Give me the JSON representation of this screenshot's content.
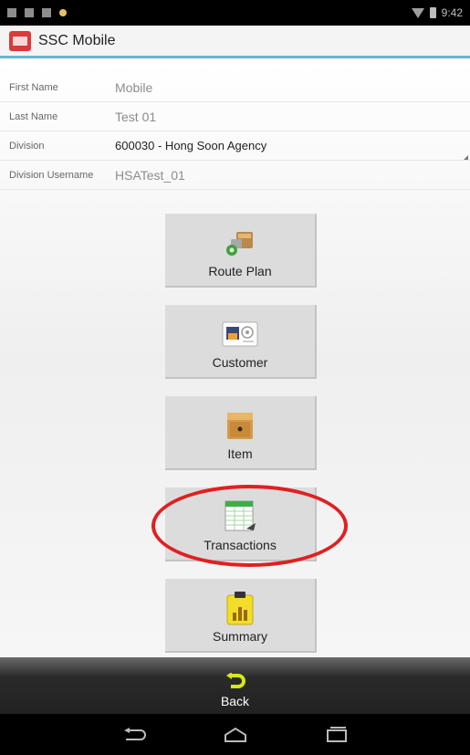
{
  "status_bar": {
    "time": "9:42"
  },
  "app": {
    "title": "SSC Mobile"
  },
  "profile": {
    "first_name": {
      "label": "First Name",
      "value": "Mobile"
    },
    "last_name": {
      "label": "Last Name",
      "value": "Test 01"
    },
    "division": {
      "label": "Division",
      "value": "600030 - Hong Soon Agency"
    },
    "division_username": {
      "label": "Division Username",
      "value": "HSATest_01"
    }
  },
  "menu": [
    {
      "label": "Route Plan",
      "icon": "route-plan-icon"
    },
    {
      "label": "Customer",
      "icon": "customer-card-icon"
    },
    {
      "label": "Item",
      "icon": "item-box-icon"
    },
    {
      "label": "Transactions",
      "icon": "transactions-sheet-icon",
      "highlighted": true
    },
    {
      "label": "Summary",
      "icon": "summary-chart-icon"
    }
  ],
  "back": {
    "label": "Back"
  },
  "colors": {
    "accent": "#6ab4cf",
    "highlight": "#e02020",
    "app_icon": "#d93a3a"
  }
}
